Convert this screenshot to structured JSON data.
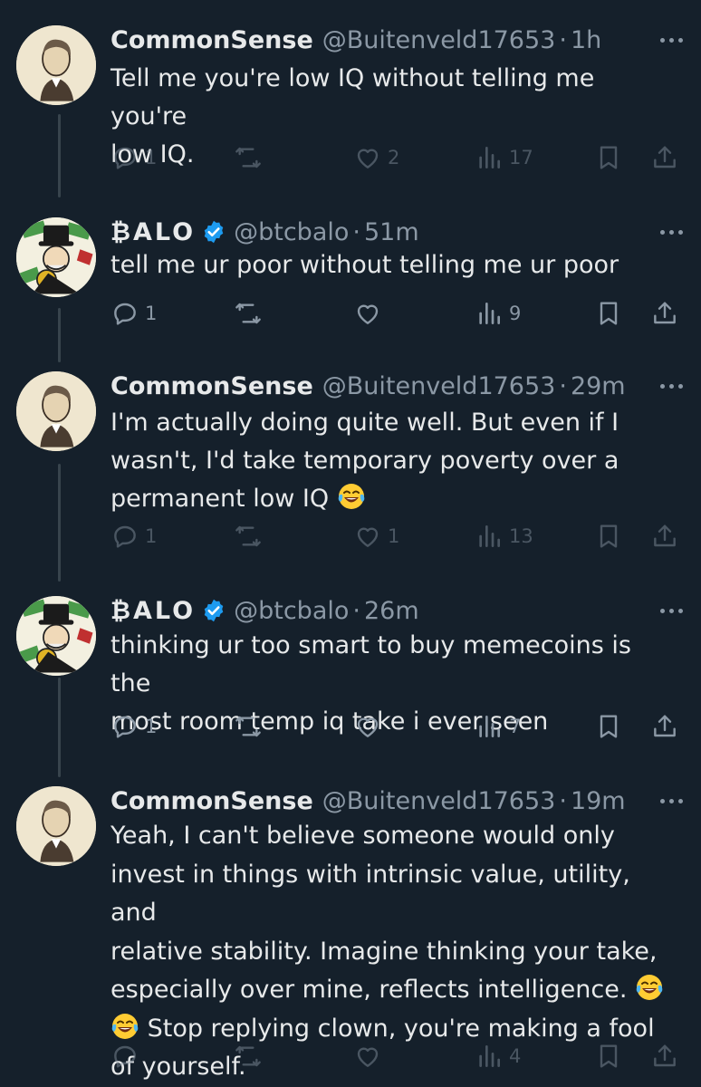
{
  "tweets": [
    {
      "name": "CommonSense",
      "handle": "@Buitenveld17653",
      "time": "1h",
      "lines": [
        "Tell me you're low IQ without telling me you're",
        "low IQ."
      ],
      "replies": "1",
      "retweets": "",
      "likes": "2",
      "views": "17",
      "avatar": "portrait-sketch",
      "verified": false
    },
    {
      "name": "₿ALO",
      "handle": "@btcbalo",
      "time": "51m",
      "lines": [
        "tell me ur poor without telling me ur poor"
      ],
      "replies": "1",
      "retweets": "",
      "likes": "",
      "views": "9",
      "avatar": "monopoly-man",
      "verified": true
    },
    {
      "name": "CommonSense",
      "handle": "@Buitenveld17653",
      "time": "29m",
      "lines": [
        "I'm actually doing quite well. But even if I",
        "wasn't, I'd take temporary poverty over a",
        "permanent low IQ"
      ],
      "replies": "1",
      "retweets": "",
      "likes": "1",
      "views": "13",
      "avatar": "portrait-sketch",
      "verified": false
    },
    {
      "name": "₿ALO",
      "handle": "@btcbalo",
      "time": "26m",
      "lines": [
        "thinking ur too smart to buy memecoins is the",
        "most room temp iq take i ever seen"
      ],
      "replies": "1",
      "retweets": "",
      "likes": "",
      "views": "7",
      "avatar": "monopoly-man",
      "verified": true
    },
    {
      "name": "CommonSense",
      "handle": "@Buitenveld17653",
      "time": "19m",
      "lines": [
        "Yeah, I can't believe someone would only",
        "invest in things with intrinsic value, utility, and",
        "relative stability. Imagine thinking your take,",
        "especially over mine, reflects intelligence.",
        "Stop replying clown, you're making a fool",
        "of yourself."
      ],
      "replies": "",
      "retweets": "",
      "likes": "",
      "views": "4",
      "avatar": "portrait-sketch",
      "verified": false
    }
  ],
  "separator": "·",
  "icons": {
    "reply": "reply-icon",
    "retweet": "retweet-icon",
    "like": "heart-icon",
    "views": "views-icon",
    "bookmark": "bookmark-icon",
    "share": "share-icon",
    "more": "more-icon",
    "verified": "verified-badge-icon",
    "emoji": "laughing-tears-emoji"
  },
  "colors": {
    "background": "#15202b",
    "text": "#e7e9ea",
    "secondary": "#8b98a5",
    "verified": "#1d9bf0"
  }
}
